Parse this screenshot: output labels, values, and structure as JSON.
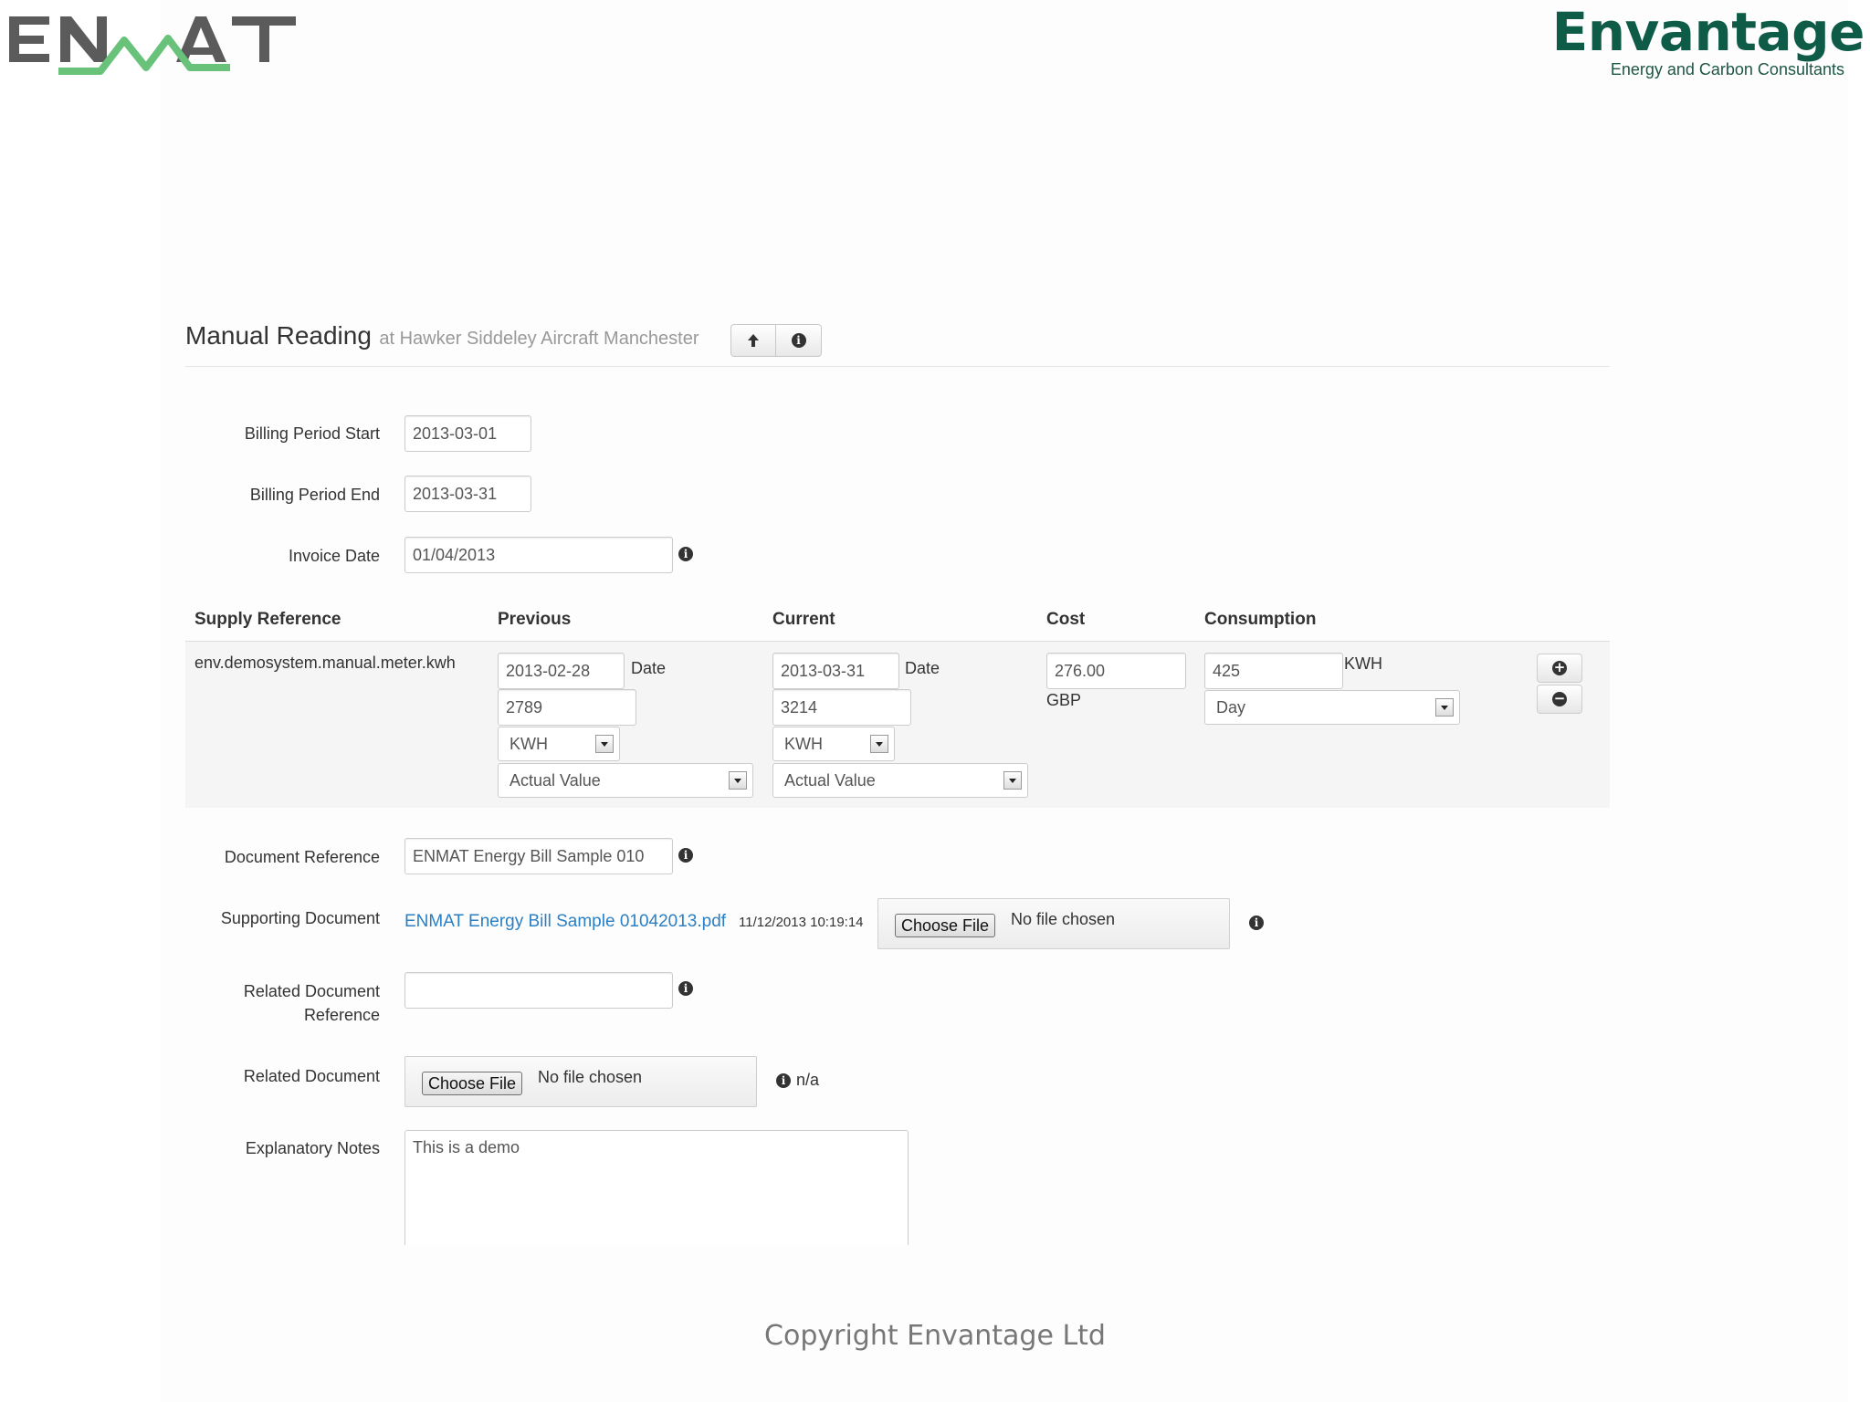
{
  "brand": {
    "enmat_logo": "ENMAT",
    "company_name": "Envantage",
    "company_tagline": "Energy and Carbon Consultants"
  },
  "heading": {
    "title": "Manual Reading",
    "subtitle": "at Hawker Siddeley Aircraft Manchester",
    "buttons": [
      "arrow-up-icon",
      "info-icon"
    ]
  },
  "form": {
    "billing_start": {
      "label": "Billing Period Start",
      "value": "2013-03-01"
    },
    "billing_end": {
      "label": "Billing Period End",
      "value": "2013-03-31"
    },
    "invoice_date": {
      "label": "Invoice Date",
      "value": "01/04/2013"
    }
  },
  "table": {
    "headers": [
      "Supply Reference",
      "Previous",
      "Current",
      "Cost",
      "Consumption"
    ],
    "row": {
      "supply_reference": "env.demosystem.manual.meter.kwh",
      "previous": {
        "date": "2013-02-28",
        "date_label": "Date",
        "reading": "2789",
        "unit": "KWH",
        "type": "Actual Value"
      },
      "current": {
        "date": "2013-03-31",
        "date_label": "Date",
        "reading": "3214",
        "unit": "KWH",
        "type": "Actual Value"
      },
      "cost": {
        "value": "276.00",
        "currency": "GBP"
      },
      "consumption": {
        "value": "425",
        "unit": "KWH",
        "period": "Day"
      }
    }
  },
  "documents": {
    "document_reference": {
      "label": "Document Reference",
      "value": "ENMAT Energy Bill Sample 010"
    },
    "supporting_document": {
      "label": "Supporting Document",
      "file_link": "ENMAT Energy Bill Sample 01042013.pdf",
      "timestamp": "11/12/2013 10:19:14",
      "choose_label": "Choose File",
      "no_file": "No file chosen"
    },
    "related_reference": {
      "label_line1": "Related Document",
      "label_line2": "Reference",
      "value": ""
    },
    "related_document": {
      "label": "Related Document",
      "choose_label": "Choose File",
      "no_file": "No file chosen",
      "status": "n/a"
    },
    "notes": {
      "label": "Explanatory Notes",
      "value": "This is a demo"
    }
  },
  "footer": {
    "text": "Copyright Envantage Ltd"
  }
}
